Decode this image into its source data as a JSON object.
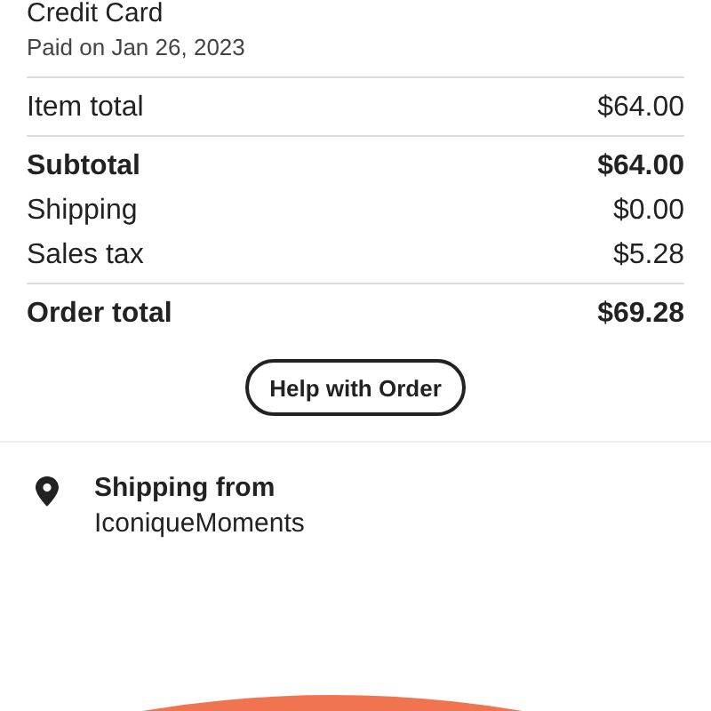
{
  "payment": {
    "method": "Credit Card",
    "paid_on": "Paid on Jan 26, 2023"
  },
  "summary": [
    {
      "kind": "plain",
      "label": "Item total",
      "value": "$64.00"
    },
    {
      "kind": "bold",
      "label": "Subtotal",
      "value": "$64.00"
    },
    {
      "kind": "plain",
      "label": "Shipping",
      "value": "$0.00"
    },
    {
      "kind": "plain",
      "label": "Sales tax",
      "value": "$5.28"
    },
    {
      "kind": "total",
      "label": "Order total",
      "value": "$69.28"
    }
  ],
  "help_button": "Help with Order",
  "shipping": {
    "title": "Shipping from",
    "shop": "IconiqueMoments"
  }
}
